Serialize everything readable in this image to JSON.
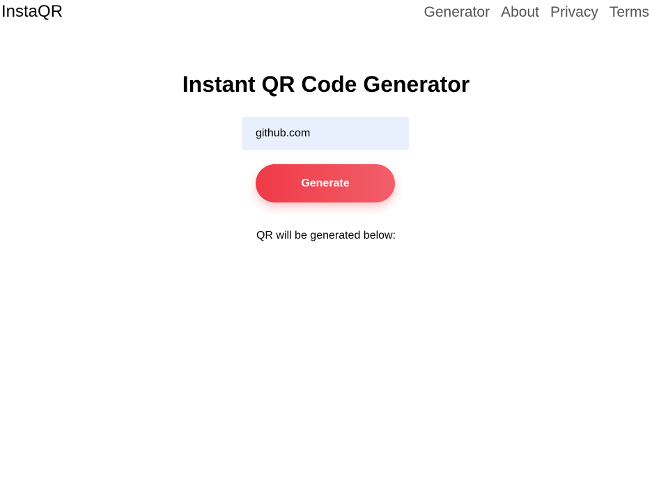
{
  "header": {
    "brand": "InstaQR",
    "nav": {
      "generator": "Generator",
      "about": "About",
      "privacy": "Privacy",
      "terms": "Terms"
    }
  },
  "main": {
    "title": "Instant QR Code Generator",
    "url_input": {
      "value": "github.com",
      "placeholder": ""
    },
    "generate_label": "Generate",
    "qr_caption": "QR will be generated below:"
  },
  "colors": {
    "accent_start": "#ef3a47",
    "accent_end": "#f15f69",
    "input_background": "#e8f0fe",
    "nav_text": "#555555"
  }
}
